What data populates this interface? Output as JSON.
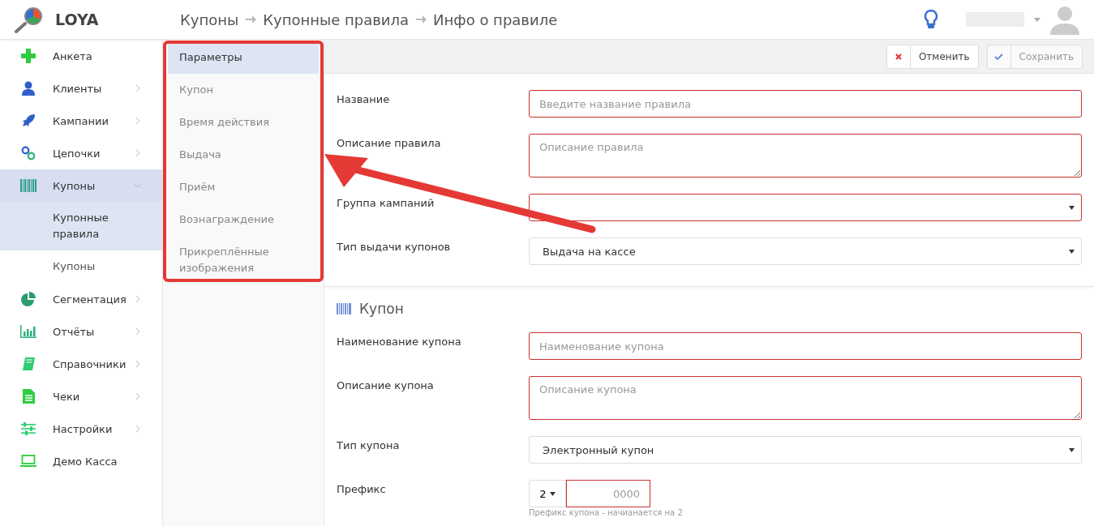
{
  "brand": "LOYA",
  "breadcrumbs": [
    "Купоны",
    "Купонные правила",
    "Инфо о правиле"
  ],
  "sidebar": {
    "items": [
      {
        "kind": "link",
        "label": "Анкета",
        "selected": false
      },
      {
        "kind": "group",
        "label": "Клиенты",
        "expanded": false,
        "selected": false
      },
      {
        "kind": "group",
        "label": "Кампании",
        "expanded": false,
        "selected": false
      },
      {
        "kind": "group",
        "label": "Цепочки",
        "expanded": false,
        "selected": false
      },
      {
        "kind": "group",
        "label": "Купоны",
        "expanded": true,
        "selected": true,
        "children": [
          {
            "label": "Купонные правила",
            "selected": true
          },
          {
            "label": "Купоны",
            "selected": false
          }
        ]
      },
      {
        "kind": "group",
        "label": "Сегментация",
        "expanded": false,
        "selected": false
      },
      {
        "kind": "group",
        "label": "Отчёты",
        "expanded": false,
        "selected": false
      },
      {
        "kind": "group",
        "label": "Справочники",
        "expanded": false,
        "selected": false
      },
      {
        "kind": "group",
        "label": "Чеки",
        "expanded": false,
        "selected": false
      },
      {
        "kind": "group",
        "label": "Настройки",
        "expanded": false,
        "selected": false
      },
      {
        "kind": "link",
        "label": "Демо Касса",
        "selected": false
      }
    ]
  },
  "section_nav": [
    {
      "label": "Параметры",
      "selected": true
    },
    {
      "label": "Купон",
      "selected": false
    },
    {
      "label": "Время действия",
      "selected": false
    },
    {
      "label": "Выдача",
      "selected": false
    },
    {
      "label": "Приём",
      "selected": false
    },
    {
      "label": "Вознаграждение",
      "selected": false
    },
    {
      "label": "Прикреплённые изображения",
      "selected": false
    }
  ],
  "toolbar": {
    "cancel": "Отменить",
    "save": "Сохранить",
    "save_disabled": true
  },
  "sections": [
    {
      "fields": [
        {
          "kind": "input",
          "label": "Название",
          "placeholder": "Введите название правила",
          "invalid": true
        },
        {
          "kind": "textarea",
          "label": "Описание правила",
          "placeholder": "Описание правила",
          "invalid": true
        },
        {
          "kind": "select",
          "label": "Группа кампаний",
          "invalid": true
        },
        {
          "kind": "select",
          "label": "Тип выдачи купонов",
          "value": "Выдача на кассе",
          "invalid": false
        }
      ]
    },
    {
      "title": "Купон",
      "fields": [
        {
          "kind": "input",
          "label": "Наименование купона",
          "placeholder": "Наименование купона",
          "invalid": true
        },
        {
          "kind": "textarea",
          "label": "Описание купона",
          "placeholder": "Описание купона",
          "invalid": true
        },
        {
          "kind": "select",
          "label": "Тип купона",
          "value": "Электронный купон",
          "invalid": false
        },
        {
          "kind": "prefix",
          "label": "Префикс",
          "digit": "2",
          "placeholder": "0000",
          "invalid": true,
          "help": "Префикс купона - начианается на 2"
        }
      ]
    }
  ],
  "annotation": {
    "shown": true
  }
}
